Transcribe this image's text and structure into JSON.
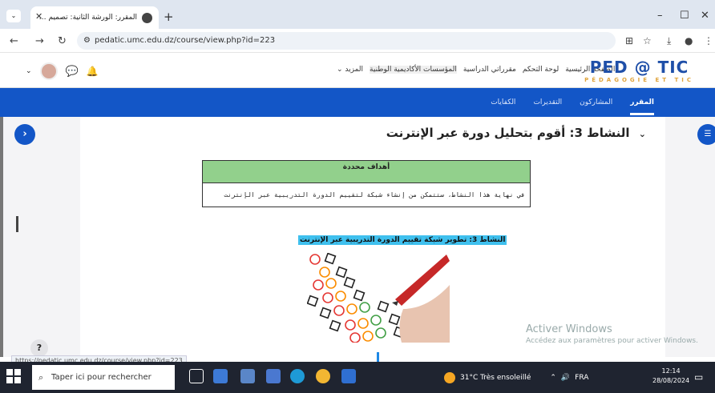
{
  "browser": {
    "tab_title": "المقرر: الورشة الثانية: تصميم مقر...",
    "new_tab": "+",
    "url": "pedatic.umc.edu.dz/course/view.php?id=223",
    "status_url": "https://pedatic.umc.edu.dz/course/view.php?id=223"
  },
  "site": {
    "logo_main": "PED @ TIC",
    "logo_sub": "PÉDAGOGIE ET TIC",
    "nav": [
      "الصفحة الرئيسية",
      "لوحة التحكم",
      "مقرراتي الدراسية",
      "المؤسسات الأكاديمية الوطنية",
      "المزيد ⌄"
    ]
  },
  "course_nav": {
    "items": [
      "المقرر",
      "المشاركون",
      "التقديرات",
      "الكفايات"
    ]
  },
  "section": {
    "title": "النشاط 3: أقوم بتحليل دورة عبر الإنترنت",
    "objectives_header": "أهداف محددة",
    "objectives_text": "في نهاية هذا النشاط، ستتمكن من إنشاء شبكة لتقييم الدورة التدريبية عبر الإنترنت",
    "highlight": "النشاط 3: تطوير شبكة تقييم الدورة التدريبية عبر الإنترنت"
  },
  "watermark": {
    "line1": "Activer Windows",
    "line2": "Accédez aux paramètres pour activer Windows."
  },
  "help": "?",
  "taskbar": {
    "search_placeholder": "Taper ici pour rechercher",
    "weather": "31°C  Très ensoleillé",
    "lang": "FRA",
    "time": "12:14",
    "date": "28/08/2024"
  },
  "colors": {
    "brand_blue": "#1356c7",
    "objectives_green": "#92d08c",
    "highlight_cyan": "#3fc0ee"
  }
}
